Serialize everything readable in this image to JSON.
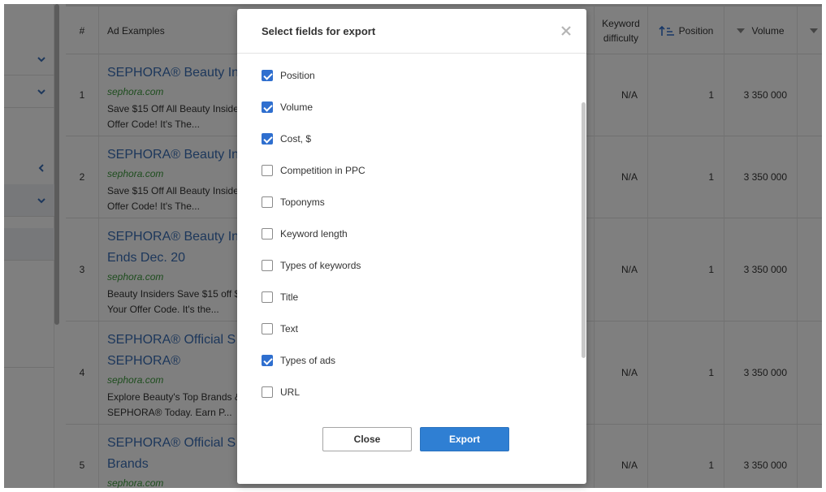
{
  "table": {
    "headers": {
      "num": "#",
      "ad_examples": "Ad Examples",
      "keyword_difficulty": "Keyword difficulty",
      "position": "Position",
      "volume": "Volume"
    },
    "rows": [
      {
        "num": "1",
        "title_lines": [
          "SEPHORA® Beauty In"
        ],
        "url": "sephora.com",
        "desc_lines": [
          "Save $15 Off All Beauty Insider",
          "Offer Code! It's The..."
        ],
        "kd": "N/A",
        "position": "1",
        "volume": "3 350 000"
      },
      {
        "num": "2",
        "title_lines": [
          "SEPHORA® Beauty In"
        ],
        "url": "sephora.com",
        "desc_lines": [
          "Save $15 Off All Beauty Insider",
          "Offer Code! It's The..."
        ],
        "kd": "N/A",
        "position": "1",
        "volume": "3 350 000"
      },
      {
        "num": "3",
        "title_lines": [
          "SEPHORA® Beauty In",
          "Ends Dec. 20"
        ],
        "url": "sephora.com",
        "desc_lines": [
          "Beauty Insiders Save $15 off $",
          "Your Offer Code. It's the..."
        ],
        "kd": "N/A",
        "position": "1",
        "volume": "3 350 000"
      },
      {
        "num": "4",
        "title_lines": [
          "SEPHORA® Official S",
          "SEPHORA®"
        ],
        "url": "sephora.com",
        "desc_lines": [
          "Explore Beauty's Top Brands &",
          "SEPHORA® Today. Earn P..."
        ],
        "kd": "N/A",
        "position": "1",
        "volume": "3 350 000"
      },
      {
        "num": "5",
        "title_lines": [
          "SEPHORA® Official S",
          "Brands"
        ],
        "url": "sephora.com",
        "desc_lines": [],
        "kd": "N/A",
        "position": "1",
        "volume": "3 350 000"
      }
    ]
  },
  "modal": {
    "title": "Select fields for export",
    "close_icon": "close-icon",
    "fields": [
      {
        "label": "Position",
        "checked": true
      },
      {
        "label": "Volume",
        "checked": true
      },
      {
        "label": "Cost, $",
        "checked": true
      },
      {
        "label": "Competition in PPC",
        "checked": false
      },
      {
        "label": "Toponyms",
        "checked": false
      },
      {
        "label": "Keyword length",
        "checked": false
      },
      {
        "label": "Types of keywords",
        "checked": false
      },
      {
        "label": "Title",
        "checked": false
      },
      {
        "label": "Text",
        "checked": false
      },
      {
        "label": "Types of ads",
        "checked": true
      },
      {
        "label": "URL",
        "checked": false
      }
    ],
    "close_label": "Close",
    "export_label": "Export"
  },
  "colors": {
    "accent": "#2f7fd3",
    "link": "#3a6fb7",
    "url_green": "#3c9a3c"
  }
}
